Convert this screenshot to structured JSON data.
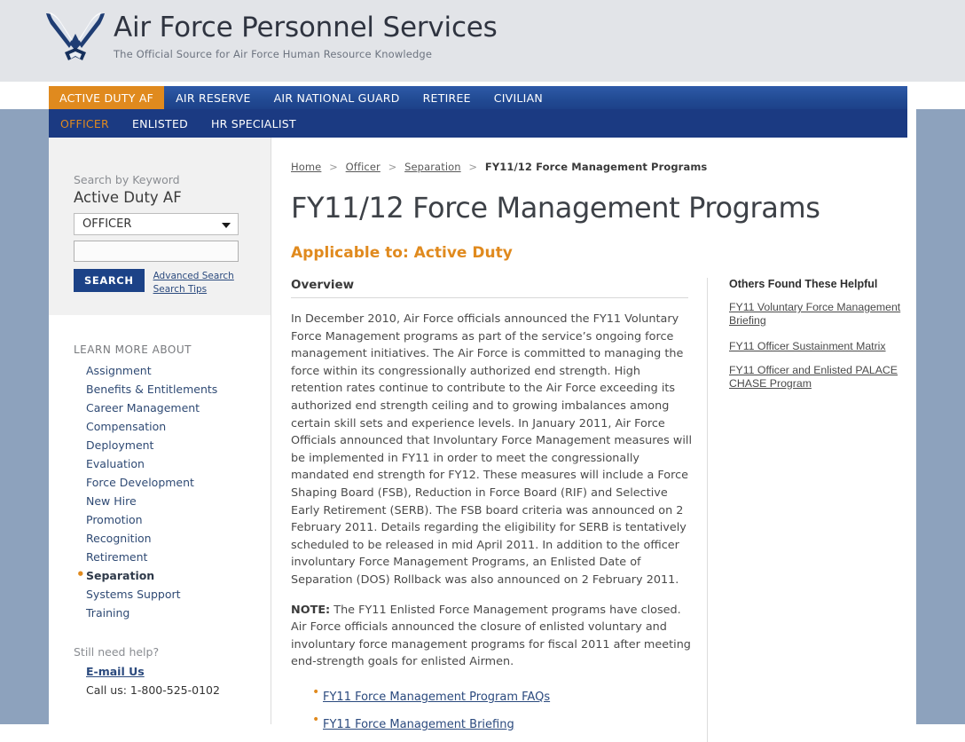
{
  "brand": {
    "title": "Air Force Personnel Services",
    "subtitle": "The Official Source for Air Force Human Resource Knowledge",
    "logo_icon": "air-force-wings-icon"
  },
  "nav_primary": {
    "items": [
      {
        "label": "ACTIVE DUTY AF",
        "active": true
      },
      {
        "label": "AIR RESERVE",
        "active": false
      },
      {
        "label": "AIR NATIONAL GUARD",
        "active": false
      },
      {
        "label": "RETIREE",
        "active": false
      },
      {
        "label": "CIVILIAN",
        "active": false
      }
    ]
  },
  "nav_secondary": {
    "items": [
      {
        "label": "OFFICER",
        "active": true
      },
      {
        "label": "ENLISTED",
        "active": false
      },
      {
        "label": "HR SPECIALIST",
        "active": false
      }
    ]
  },
  "sidebar": {
    "search": {
      "label": "Search by Keyword",
      "heading": "Active Duty AF",
      "select_value": "OFFICER",
      "select_caret_icon": "chevron-down-icon",
      "keyword_value": "",
      "keyword_placeholder": "",
      "button_label": "SEARCH",
      "advanced_search_label": "Advanced Search",
      "search_tips_label": "Search Tips"
    },
    "learn_more": {
      "title": "LEARN MORE ABOUT",
      "items": [
        {
          "label": "Assignment",
          "active": false
        },
        {
          "label": "Benefits & Entitlements",
          "active": false
        },
        {
          "label": "Career Management",
          "active": false
        },
        {
          "label": "Compensation",
          "active": false
        },
        {
          "label": "Deployment",
          "active": false
        },
        {
          "label": "Evaluation",
          "active": false
        },
        {
          "label": "Force Development",
          "active": false
        },
        {
          "label": "New Hire",
          "active": false
        },
        {
          "label": "Promotion",
          "active": false
        },
        {
          "label": "Recognition",
          "active": false
        },
        {
          "label": "Retirement",
          "active": false
        },
        {
          "label": "Separation",
          "active": true
        },
        {
          "label": "Systems Support",
          "active": false
        },
        {
          "label": "Training",
          "active": false
        }
      ]
    },
    "help": {
      "title": "Still need help?",
      "email_label": "E-mail Us",
      "phone": "Call us: 1-800-525-0102"
    }
  },
  "main": {
    "breadcrumb": {
      "items": [
        {
          "label": "Home",
          "current": false
        },
        {
          "label": "Officer",
          "current": false
        },
        {
          "label": "Separation",
          "current": false
        },
        {
          "label": "FY11/12 Force Management Programs",
          "current": true
        }
      ],
      "separator": ">"
    },
    "page_title": "FY11/12 Force Management Programs",
    "applicable_to": "Applicable to: Active Duty",
    "section_heading": "Overview",
    "paragraph_1": "In December 2010, Air Force officials announced the FY11 Voluntary Force Management programs as part of the service’s ongoing force management initiatives. The Air Force is committed to managing the force within its congressionally authorized end strength. High retention rates continue to contribute to the Air Force exceeding its authorized end strength ceiling and to growing imbalances among certain skill sets and experience levels. In January 2011, Air Force Officials announced that Involuntary Force Management measures will be implemented in FY11 in order to meet the congressionally mandated end strength for FY12. These measures will include a Force Shaping Board (FSB), Reduction in Force Board (RIF) and Selective Early Retirement (SERB). The FSB board criteria was announced on 2 February 2011. Details regarding the eligibility for SERB is tentatively scheduled to be released in mid April 2011. In addition to the officer involuntary Force Management Programs, an Enlisted Date of Separation (DOS) Rollback was also announced on 2 February 2011.",
    "note_label": "NOTE:",
    "note_text": " The FY11 Enlisted Force Management programs have closed. Air Force officials announced the closure of enlisted voluntary and involuntary force management programs for fiscal 2011 after meeting end-strength goals for enlisted Airmen.",
    "doc_links": [
      {
        "label": "FY11 Force Management Program FAQs"
      },
      {
        "label": "FY11 Force Management Briefing"
      }
    ]
  },
  "aside": {
    "title": "Others Found These Helpful",
    "links": [
      {
        "label": "FY11 Voluntary Force Management Briefing"
      },
      {
        "label": "FY11 Officer Sustainment Matrix"
      },
      {
        "label": "FY11 Officer and Enlisted PALACE CHASE Program"
      }
    ]
  },
  "colors": {
    "accent_orange": "#e08a1e",
    "nav_blue": "#1b3a82",
    "nav_blue_light": "#2e5aa8",
    "link_blue": "#2b4a7e",
    "page_band": "#8da2bd",
    "header_bg": "#e2e4e8"
  }
}
